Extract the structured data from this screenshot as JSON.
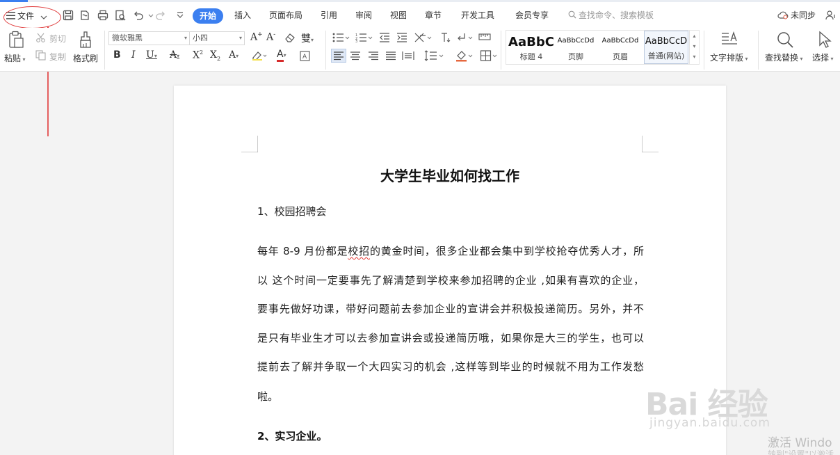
{
  "menubar": {
    "file_label": "文件",
    "tabs": [
      "开始",
      "插入",
      "页面布局",
      "引用",
      "审阅",
      "视图",
      "章节",
      "开发工具",
      "会员专享"
    ],
    "search_placeholder": "查找命令、搜索模板",
    "sync_label": "未同步",
    "accent_color": "#3b7ff0"
  },
  "ribbon": {
    "paste_label": "粘贴",
    "cut_label": "剪切",
    "copy_label": "复制",
    "format_painter_label": "格式刷",
    "font_name": "微软雅黑",
    "font_size": "小四",
    "styles": [
      {
        "preview": "AaBbC",
        "label": "标题 4"
      },
      {
        "preview": "AaBbCcDd",
        "label": "页脚"
      },
      {
        "preview": "AaBbCcDd",
        "label": "页眉"
      },
      {
        "preview": "AaBbCcD",
        "label": "普通(网站)"
      }
    ],
    "text_layout_label": "文字排版",
    "find_replace_label": "查找替换",
    "select_label": "选择"
  },
  "document": {
    "title": "大学生毕业如何找工作",
    "heading1": "1、校园招聘会",
    "paragraph_lines": [
      "每年 8-9 月份都是校招的黄金时间，很多企业都会集中到学校抢夺优秀人才，所",
      "以 这个时间一定要事先了解清楚到学校来参加招聘的企业 ,如果有喜欢的企业，",
      "要事先做好功课，带好问题前去参加企业的宣讲会并积极投递简历。另外，并不",
      "是只有毕业生才可以去参加宣讲会或投递简历哦，如果你是大三的学生，也可以",
      "提前去了解并争取一个大四实习的机会 ,这样等到毕业的时候就不用为工作发愁",
      "啦。"
    ],
    "heading2": "2、实习企业。"
  },
  "watermarks": {
    "baidu_logo": "Bai 经验",
    "baidu_url": "jingyan.baidu.com",
    "windows_activation": "激活 Windo",
    "windows_activation_sub": "转到\"设置\"以激活"
  },
  "annotation_color": "#e03a3a"
}
